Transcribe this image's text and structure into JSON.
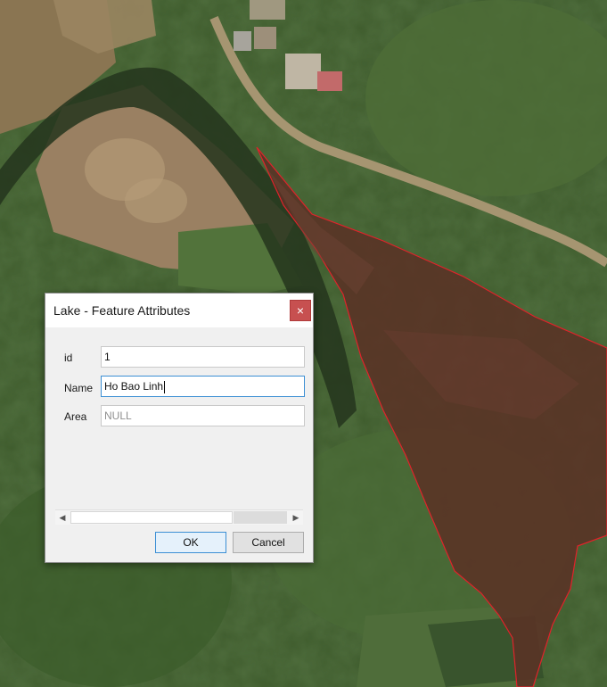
{
  "colors": {
    "lake_fill": "#5a3226",
    "lake_outline": "#e0222a",
    "vegetation": "#3e5a2c",
    "dirt_road": "#b09a78",
    "close_button": "#c75050",
    "focus_border": "#3c8fd4"
  },
  "map": {
    "content": "satellite imagery with lake polygon"
  },
  "dialog": {
    "title": "Lake - Feature Attributes",
    "close_icon": "×",
    "fields": [
      {
        "label": "id",
        "value": "1"
      },
      {
        "label": "Name",
        "value": "Ho Bao Linh"
      },
      {
        "label": "Area",
        "value": "NULL"
      }
    ],
    "scroll_left_icon": "◀",
    "scroll_right_icon": "▶",
    "ok_label": "OK",
    "cancel_label": "Cancel"
  }
}
